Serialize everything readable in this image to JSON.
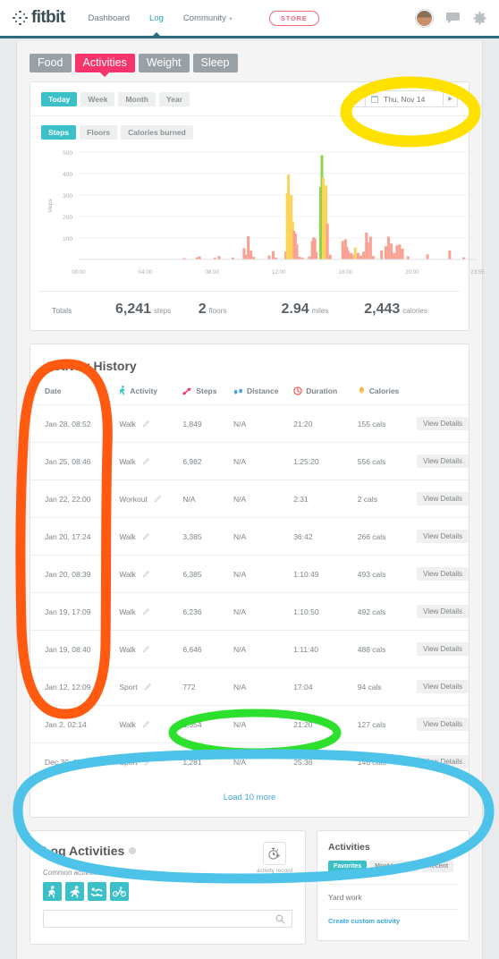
{
  "nav": {
    "brand": "fitbit",
    "links": [
      {
        "label": "Dashboard",
        "active": false
      },
      {
        "label": "Log",
        "active": true
      },
      {
        "label": "Community",
        "active": false
      }
    ],
    "store_label": "STORE",
    "icons": [
      "avatar",
      "chat-icon",
      "gear-icon"
    ]
  },
  "subtabs": [
    {
      "label": "Food",
      "active": false
    },
    {
      "label": "Activities",
      "active": true
    },
    {
      "label": "Weight",
      "active": false
    },
    {
      "label": "Sleep",
      "active": false
    }
  ],
  "chart_panel": {
    "ranges": [
      {
        "label": "Today",
        "active": true
      },
      {
        "label": "Week",
        "active": false
      },
      {
        "label": "Month",
        "active": false
      },
      {
        "label": "Year",
        "active": false
      }
    ],
    "date": "Thu, Nov 14",
    "prev_label": "◀",
    "next_label": "▶",
    "metrics": [
      {
        "label": "Steps",
        "active": true
      },
      {
        "label": "Floors",
        "active": false
      },
      {
        "label": "Calories burned",
        "active": false
      }
    ],
    "totals_label": "Totals",
    "totals": [
      {
        "value": "6,241",
        "unit": "steps"
      },
      {
        "value": "2",
        "unit": "floors"
      },
      {
        "value": "2.94",
        "unit": "miles"
      },
      {
        "value": "2,443",
        "unit": "calories"
      }
    ]
  },
  "chart_data": {
    "type": "bar",
    "title": "",
    "xlabel": "",
    "ylabel": "steps",
    "ylim": [
      0,
      500
    ],
    "yticks": [
      100,
      200,
      300,
      400,
      500
    ],
    "xticks": [
      "00:00",
      "04:00",
      "08:00",
      "12:00",
      "16:00",
      "20:00",
      "23:55"
    ],
    "grid": true,
    "legend": "none",
    "bar_colors": {
      "normal": "#f9a193",
      "moderate": "#fcd45a",
      "active": "#8fd24b"
    },
    "x_unit": "5-minute intervals from 00:00 to 23:55",
    "series": [
      {
        "name": "steps per 5-min interval",
        "points": [
          {
            "time": "06:20",
            "value": 6,
            "zone": "normal"
          },
          {
            "time": "07:05",
            "value": 10,
            "zone": "normal"
          },
          {
            "time": "07:15",
            "value": 14,
            "zone": "normal"
          },
          {
            "time": "08:10",
            "value": 8,
            "zone": "normal"
          },
          {
            "time": "08:25",
            "value": 16,
            "zone": "normal"
          },
          {
            "time": "09:15",
            "value": 9,
            "zone": "normal"
          },
          {
            "time": "09:55",
            "value": 52,
            "zone": "normal"
          },
          {
            "time": "10:00",
            "value": 22,
            "zone": "normal"
          },
          {
            "time": "10:10",
            "value": 108,
            "zone": "normal"
          },
          {
            "time": "10:20",
            "value": 41,
            "zone": "normal"
          },
          {
            "time": "10:30",
            "value": 12,
            "zone": "normal"
          },
          {
            "time": "11:25",
            "value": 18,
            "zone": "normal"
          },
          {
            "time": "11:40",
            "value": 38,
            "zone": "normal"
          },
          {
            "time": "11:50",
            "value": 9,
            "zone": "normal"
          },
          {
            "time": "12:25",
            "value": 36,
            "zone": "normal"
          },
          {
            "time": "12:30",
            "value": 310,
            "zone": "moderate"
          },
          {
            "time": "12:35",
            "value": 395,
            "zone": "moderate"
          },
          {
            "time": "12:40",
            "value": 218,
            "zone": "moderate"
          },
          {
            "time": "12:45",
            "value": 300,
            "zone": "moderate"
          },
          {
            "time": "12:50",
            "value": 175,
            "zone": "moderate"
          },
          {
            "time": "12:55",
            "value": 133,
            "zone": "normal"
          },
          {
            "time": "13:00",
            "value": 120,
            "zone": "normal"
          },
          {
            "time": "13:05",
            "value": 70,
            "zone": "normal"
          },
          {
            "time": "13:15",
            "value": 12,
            "zone": "normal"
          },
          {
            "time": "13:25",
            "value": 8,
            "zone": "normal"
          },
          {
            "time": "13:50",
            "value": 14,
            "zone": "normal"
          },
          {
            "time": "14:00",
            "value": 86,
            "zone": "normal"
          },
          {
            "time": "14:05",
            "value": 103,
            "zone": "normal"
          },
          {
            "time": "14:10",
            "value": 97,
            "zone": "normal"
          },
          {
            "time": "14:15",
            "value": 35,
            "zone": "normal"
          },
          {
            "time": "14:30",
            "value": 338,
            "zone": "active"
          },
          {
            "time": "14:35",
            "value": 485,
            "zone": "active"
          },
          {
            "time": "14:40",
            "value": 380,
            "zone": "moderate"
          },
          {
            "time": "14:45",
            "value": 290,
            "zone": "moderate"
          },
          {
            "time": "14:50",
            "value": 345,
            "zone": "moderate"
          },
          {
            "time": "14:55",
            "value": 166,
            "zone": "normal"
          },
          {
            "time": "15:05",
            "value": 22,
            "zone": "normal"
          },
          {
            "time": "15:50",
            "value": 86,
            "zone": "normal"
          },
          {
            "time": "15:55",
            "value": 66,
            "zone": "normal"
          },
          {
            "time": "16:00",
            "value": 94,
            "zone": "normal"
          },
          {
            "time": "16:05",
            "value": 58,
            "zone": "normal"
          },
          {
            "time": "16:10",
            "value": 40,
            "zone": "normal"
          },
          {
            "time": "16:20",
            "value": 30,
            "zone": "normal"
          },
          {
            "time": "16:30",
            "value": 22,
            "zone": "normal"
          },
          {
            "time": "16:35",
            "value": 56,
            "zone": "moderate"
          },
          {
            "time": "16:45",
            "value": 30,
            "zone": "normal"
          },
          {
            "time": "16:55",
            "value": 18,
            "zone": "normal"
          },
          {
            "time": "17:05",
            "value": 36,
            "zone": "normal"
          },
          {
            "time": "17:15",
            "value": 125,
            "zone": "normal"
          },
          {
            "time": "17:20",
            "value": 80,
            "zone": "normal"
          },
          {
            "time": "17:30",
            "value": 106,
            "zone": "normal"
          },
          {
            "time": "17:40",
            "value": 16,
            "zone": "normal"
          },
          {
            "time": "18:10",
            "value": 42,
            "zone": "normal"
          },
          {
            "time": "18:25",
            "value": 62,
            "zone": "normal"
          },
          {
            "time": "18:35",
            "value": 106,
            "zone": "normal"
          },
          {
            "time": "18:45",
            "value": 74,
            "zone": "normal"
          },
          {
            "time": "18:55",
            "value": 30,
            "zone": "normal"
          },
          {
            "time": "19:05",
            "value": 66,
            "zone": "normal"
          },
          {
            "time": "19:15",
            "value": 70,
            "zone": "normal"
          },
          {
            "time": "19:25",
            "value": 50,
            "zone": "normal"
          },
          {
            "time": "19:45",
            "value": 14,
            "zone": "normal"
          },
          {
            "time": "20:55",
            "value": 24,
            "zone": "normal"
          },
          {
            "time": "22:15",
            "value": 42,
            "zone": "normal"
          },
          {
            "time": "23:05",
            "value": 10,
            "zone": "normal"
          }
        ]
      }
    ]
  },
  "history": {
    "title": "Activity History",
    "columns": [
      {
        "label": "Date",
        "icon": "none"
      },
      {
        "label": "Activity",
        "icon": "walking-icon"
      },
      {
        "label": "Steps",
        "icon": "footsteps-icon"
      },
      {
        "label": "Distance",
        "icon": "footprints-icon"
      },
      {
        "label": "Duration",
        "icon": "clock-icon"
      },
      {
        "label": "Calories",
        "icon": "flame-icon"
      },
      {
        "label": "",
        "icon": "none"
      }
    ],
    "rows": [
      {
        "date": "Jan 28, 08:52",
        "activity": "Walk",
        "steps": "1,849",
        "distance": "N/A",
        "duration": "21:20",
        "calories": "155 cals",
        "action": "View Details"
      },
      {
        "date": "Jan 25, 08:46",
        "activity": "Walk",
        "steps": "6,982",
        "distance": "N/A",
        "duration": "1:25:20",
        "calories": "556 cals",
        "action": "View Details"
      },
      {
        "date": "Jan 22, 22:00",
        "activity": "Workout",
        "steps": "N/A",
        "distance": "N/A",
        "duration": "2:31",
        "calories": "2 cals",
        "action": "View Details"
      },
      {
        "date": "Jan 20, 17:24",
        "activity": "Walk",
        "steps": "3,385",
        "distance": "N/A",
        "duration": "36:42",
        "calories": "266 cals",
        "action": "View Details"
      },
      {
        "date": "Jan 20, 08:39",
        "activity": "Walk",
        "steps": "6,385",
        "distance": "N/A",
        "duration": "1:10:49",
        "calories": "493 cals",
        "action": "View Details"
      },
      {
        "date": "Jan 19, 17:09",
        "activity": "Walk",
        "steps": "6,236",
        "distance": "N/A",
        "duration": "1:10:50",
        "calories": "492 cals",
        "action": "View Details"
      },
      {
        "date": "Jan 19, 08:40",
        "activity": "Walk",
        "steps": "6,646",
        "distance": "N/A",
        "duration": "1:11:40",
        "calories": "488 cals",
        "action": "View Details"
      },
      {
        "date": "Jan 12, 12:09",
        "activity": "Sport",
        "steps": "772",
        "distance": "N/A",
        "duration": "17:04",
        "calories": "94 cals",
        "action": "View Details"
      },
      {
        "date": "Jan 2, 02:14",
        "activity": "Walk",
        "steps": "1,354",
        "distance": "N/A",
        "duration": "21:20",
        "calories": "127 cals",
        "action": "View Details"
      },
      {
        "date": "Dec 30, 15:36",
        "activity": "Sport",
        "steps": "1,281",
        "distance": "N/A",
        "duration": "25:36",
        "calories": "146 cals",
        "action": "View Details"
      }
    ],
    "load_more": "Load 10 more"
  },
  "log_activities": {
    "title": "Log Activities",
    "common_label": "Common activities",
    "icons": [
      "walk-icon",
      "run-icon",
      "swim-icon",
      "bike-icon"
    ],
    "search_placeholder": "",
    "search_value": "",
    "record_label": "activity record"
  },
  "activities_panel": {
    "title": "Activities",
    "tabs": [
      {
        "label": "Favorites",
        "active": true
      },
      {
        "label": "Most Logged",
        "active": false
      },
      {
        "label": "Recent",
        "active": false
      }
    ],
    "items": [
      "Yard work"
    ],
    "create_link": "Create custom activity"
  },
  "annotations": {
    "yellow_ellipse": "date-picker highlight",
    "orange_ellipse": "date-column highlight",
    "green_ellipse": "load-more highlight",
    "blue_ellipse": "log-activities-section highlight",
    "colors": {
      "yellow": "#ffe100",
      "orange": "#ff5a10",
      "green": "#2ee02e",
      "blue": "#4ec3ea"
    }
  }
}
